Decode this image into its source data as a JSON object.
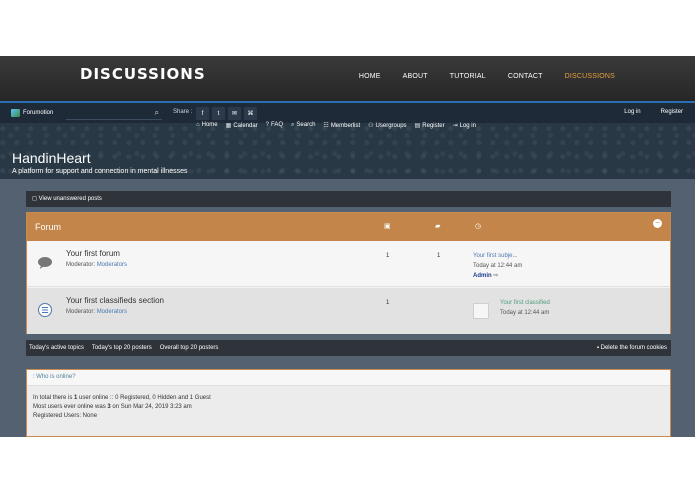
{
  "site": {
    "logo": "DISCUSSIONS",
    "nav": [
      "HOME",
      "ABOUT",
      "TUTORIAL",
      "CONTACT",
      "DISCUSSIONS"
    ],
    "active_nav": "DISCUSSIONS",
    "accent_color": "#e7a33e"
  },
  "toolbar": {
    "brand": "Forumotion",
    "search_placeholder": "",
    "share_label": "Share :",
    "share_icons": [
      "f",
      "t",
      "✉",
      "⌘"
    ],
    "login": "Log in",
    "register": "Register"
  },
  "banner": {
    "nav": [
      "Home",
      "Calendar",
      "FAQ",
      "Search",
      "Memberlist",
      "Usergroups",
      "Register",
      "Log in"
    ],
    "title": "HandinHeart",
    "description": "A platform for support and connection in mental illnesses"
  },
  "forum": {
    "unanswered": "View unanswered posts",
    "header": "Forum",
    "header_color": "#c4854a",
    "rows": [
      {
        "name": "Your first forum",
        "mods_label": "Moderator:",
        "mods": "Moderators",
        "topics": "1",
        "posts": "1",
        "last_subject": "Your first subje...",
        "last_time": "Today at 12:44 am",
        "last_user": "Admin"
      },
      {
        "name": "Your first classifieds section",
        "mods_label": "Moderator:",
        "mods": "Moderators",
        "topics": "1",
        "posts": "",
        "last_subject": "Your first classified",
        "last_time": "Today at 12:44 am"
      }
    ]
  },
  "bottom_bar": {
    "links": [
      "Today's active topics",
      "Today's top 20 posters",
      "Overall top 20 posters"
    ],
    "cookies": "Delete the forum cookies"
  },
  "online": {
    "title": "Who is online?",
    "line1_a": "In total there is ",
    "line1_count": "1",
    "line1_b": " user online :: 0 Registered, 0 Hidden and 1 Guest",
    "line2_a": "Most users ever online was ",
    "line2_count": "3",
    "line2_b": " on Sun Mar 24, 2019 3:23 am",
    "line3": "Registered Users: None"
  }
}
